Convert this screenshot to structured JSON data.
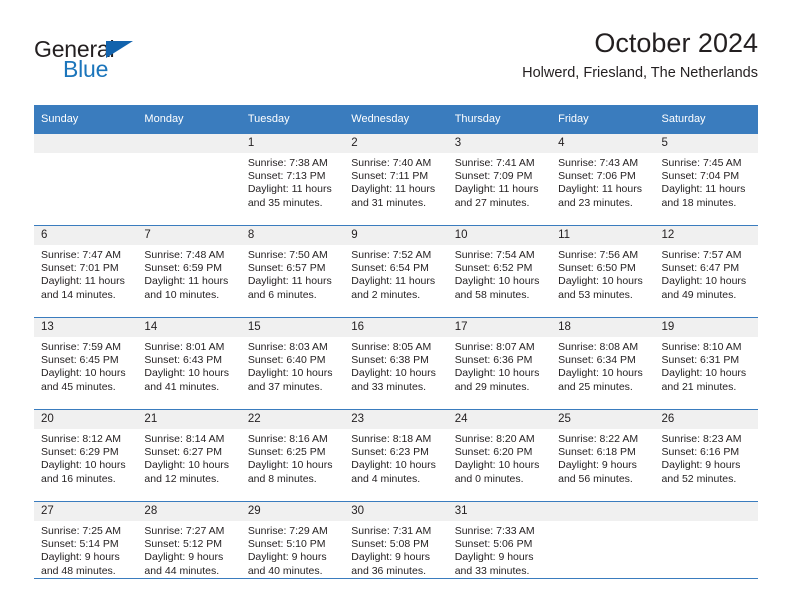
{
  "brand": {
    "name_dark": "General",
    "name_blue": "Blue",
    "triangle_color": "#1263ad",
    "blue_color": "#1b75bb"
  },
  "header": {
    "title": "October 2024",
    "subtitle": "Holwerd, Friesland, The Netherlands"
  },
  "theme": {
    "header_row_bg": "#3a7cbe",
    "daynum_bg": "#f0f0f0",
    "text_color": "#231f20",
    "rule_color": "#3a7cbe"
  },
  "weekday_headers": [
    "Sunday",
    "Monday",
    "Tuesday",
    "Wednesday",
    "Thursday",
    "Friday",
    "Saturday"
  ],
  "weeks": [
    [
      {
        "day": "",
        "sunrise": "",
        "sunset": "",
        "daylight1": "",
        "daylight2": "",
        "empty": true
      },
      {
        "day": "",
        "sunrise": "",
        "sunset": "",
        "daylight1": "",
        "daylight2": "",
        "empty": true
      },
      {
        "day": "1",
        "sunrise": "Sunrise: 7:38 AM",
        "sunset": "Sunset: 7:13 PM",
        "daylight1": "Daylight: 11 hours",
        "daylight2": "and 35 minutes."
      },
      {
        "day": "2",
        "sunrise": "Sunrise: 7:40 AM",
        "sunset": "Sunset: 7:11 PM",
        "daylight1": "Daylight: 11 hours",
        "daylight2": "and 31 minutes."
      },
      {
        "day": "3",
        "sunrise": "Sunrise: 7:41 AM",
        "sunset": "Sunset: 7:09 PM",
        "daylight1": "Daylight: 11 hours",
        "daylight2": "and 27 minutes."
      },
      {
        "day": "4",
        "sunrise": "Sunrise: 7:43 AM",
        "sunset": "Sunset: 7:06 PM",
        "daylight1": "Daylight: 11 hours",
        "daylight2": "and 23 minutes."
      },
      {
        "day": "5",
        "sunrise": "Sunrise: 7:45 AM",
        "sunset": "Sunset: 7:04 PM",
        "daylight1": "Daylight: 11 hours",
        "daylight2": "and 18 minutes."
      }
    ],
    [
      {
        "day": "6",
        "sunrise": "Sunrise: 7:47 AM",
        "sunset": "Sunset: 7:01 PM",
        "daylight1": "Daylight: 11 hours",
        "daylight2": "and 14 minutes."
      },
      {
        "day": "7",
        "sunrise": "Sunrise: 7:48 AM",
        "sunset": "Sunset: 6:59 PM",
        "daylight1": "Daylight: 11 hours",
        "daylight2": "and 10 minutes."
      },
      {
        "day": "8",
        "sunrise": "Sunrise: 7:50 AM",
        "sunset": "Sunset: 6:57 PM",
        "daylight1": "Daylight: 11 hours",
        "daylight2": "and 6 minutes."
      },
      {
        "day": "9",
        "sunrise": "Sunrise: 7:52 AM",
        "sunset": "Sunset: 6:54 PM",
        "daylight1": "Daylight: 11 hours",
        "daylight2": "and 2 minutes."
      },
      {
        "day": "10",
        "sunrise": "Sunrise: 7:54 AM",
        "sunset": "Sunset: 6:52 PM",
        "daylight1": "Daylight: 10 hours",
        "daylight2": "and 58 minutes."
      },
      {
        "day": "11",
        "sunrise": "Sunrise: 7:56 AM",
        "sunset": "Sunset: 6:50 PM",
        "daylight1": "Daylight: 10 hours",
        "daylight2": "and 53 minutes."
      },
      {
        "day": "12",
        "sunrise": "Sunrise: 7:57 AM",
        "sunset": "Sunset: 6:47 PM",
        "daylight1": "Daylight: 10 hours",
        "daylight2": "and 49 minutes."
      }
    ],
    [
      {
        "day": "13",
        "sunrise": "Sunrise: 7:59 AM",
        "sunset": "Sunset: 6:45 PM",
        "daylight1": "Daylight: 10 hours",
        "daylight2": "and 45 minutes."
      },
      {
        "day": "14",
        "sunrise": "Sunrise: 8:01 AM",
        "sunset": "Sunset: 6:43 PM",
        "daylight1": "Daylight: 10 hours",
        "daylight2": "and 41 minutes."
      },
      {
        "day": "15",
        "sunrise": "Sunrise: 8:03 AM",
        "sunset": "Sunset: 6:40 PM",
        "daylight1": "Daylight: 10 hours",
        "daylight2": "and 37 minutes."
      },
      {
        "day": "16",
        "sunrise": "Sunrise: 8:05 AM",
        "sunset": "Sunset: 6:38 PM",
        "daylight1": "Daylight: 10 hours",
        "daylight2": "and 33 minutes."
      },
      {
        "day": "17",
        "sunrise": "Sunrise: 8:07 AM",
        "sunset": "Sunset: 6:36 PM",
        "daylight1": "Daylight: 10 hours",
        "daylight2": "and 29 minutes."
      },
      {
        "day": "18",
        "sunrise": "Sunrise: 8:08 AM",
        "sunset": "Sunset: 6:34 PM",
        "daylight1": "Daylight: 10 hours",
        "daylight2": "and 25 minutes."
      },
      {
        "day": "19",
        "sunrise": "Sunrise: 8:10 AM",
        "sunset": "Sunset: 6:31 PM",
        "daylight1": "Daylight: 10 hours",
        "daylight2": "and 21 minutes."
      }
    ],
    [
      {
        "day": "20",
        "sunrise": "Sunrise: 8:12 AM",
        "sunset": "Sunset: 6:29 PM",
        "daylight1": "Daylight: 10 hours",
        "daylight2": "and 16 minutes."
      },
      {
        "day": "21",
        "sunrise": "Sunrise: 8:14 AM",
        "sunset": "Sunset: 6:27 PM",
        "daylight1": "Daylight: 10 hours",
        "daylight2": "and 12 minutes."
      },
      {
        "day": "22",
        "sunrise": "Sunrise: 8:16 AM",
        "sunset": "Sunset: 6:25 PM",
        "daylight1": "Daylight: 10 hours",
        "daylight2": "and 8 minutes."
      },
      {
        "day": "23",
        "sunrise": "Sunrise: 8:18 AM",
        "sunset": "Sunset: 6:23 PM",
        "daylight1": "Daylight: 10 hours",
        "daylight2": "and 4 minutes."
      },
      {
        "day": "24",
        "sunrise": "Sunrise: 8:20 AM",
        "sunset": "Sunset: 6:20 PM",
        "daylight1": "Daylight: 10 hours",
        "daylight2": "and 0 minutes."
      },
      {
        "day": "25",
        "sunrise": "Sunrise: 8:22 AM",
        "sunset": "Sunset: 6:18 PM",
        "daylight1": "Daylight: 9 hours",
        "daylight2": "and 56 minutes."
      },
      {
        "day": "26",
        "sunrise": "Sunrise: 8:23 AM",
        "sunset": "Sunset: 6:16 PM",
        "daylight1": "Daylight: 9 hours",
        "daylight2": "and 52 minutes."
      }
    ],
    [
      {
        "day": "27",
        "sunrise": "Sunrise: 7:25 AM",
        "sunset": "Sunset: 5:14 PM",
        "daylight1": "Daylight: 9 hours",
        "daylight2": "and 48 minutes."
      },
      {
        "day": "28",
        "sunrise": "Sunrise: 7:27 AM",
        "sunset": "Sunset: 5:12 PM",
        "daylight1": "Daylight: 9 hours",
        "daylight2": "and 44 minutes."
      },
      {
        "day": "29",
        "sunrise": "Sunrise: 7:29 AM",
        "sunset": "Sunset: 5:10 PM",
        "daylight1": "Daylight: 9 hours",
        "daylight2": "and 40 minutes."
      },
      {
        "day": "30",
        "sunrise": "Sunrise: 7:31 AM",
        "sunset": "Sunset: 5:08 PM",
        "daylight1": "Daylight: 9 hours",
        "daylight2": "and 36 minutes."
      },
      {
        "day": "31",
        "sunrise": "Sunrise: 7:33 AM",
        "sunset": "Sunset: 5:06 PM",
        "daylight1": "Daylight: 9 hours",
        "daylight2": "and 33 minutes."
      },
      {
        "day": "",
        "sunrise": "",
        "sunset": "",
        "daylight1": "",
        "daylight2": "",
        "empty": true
      },
      {
        "day": "",
        "sunrise": "",
        "sunset": "",
        "daylight1": "",
        "daylight2": "",
        "empty": true
      }
    ]
  ]
}
